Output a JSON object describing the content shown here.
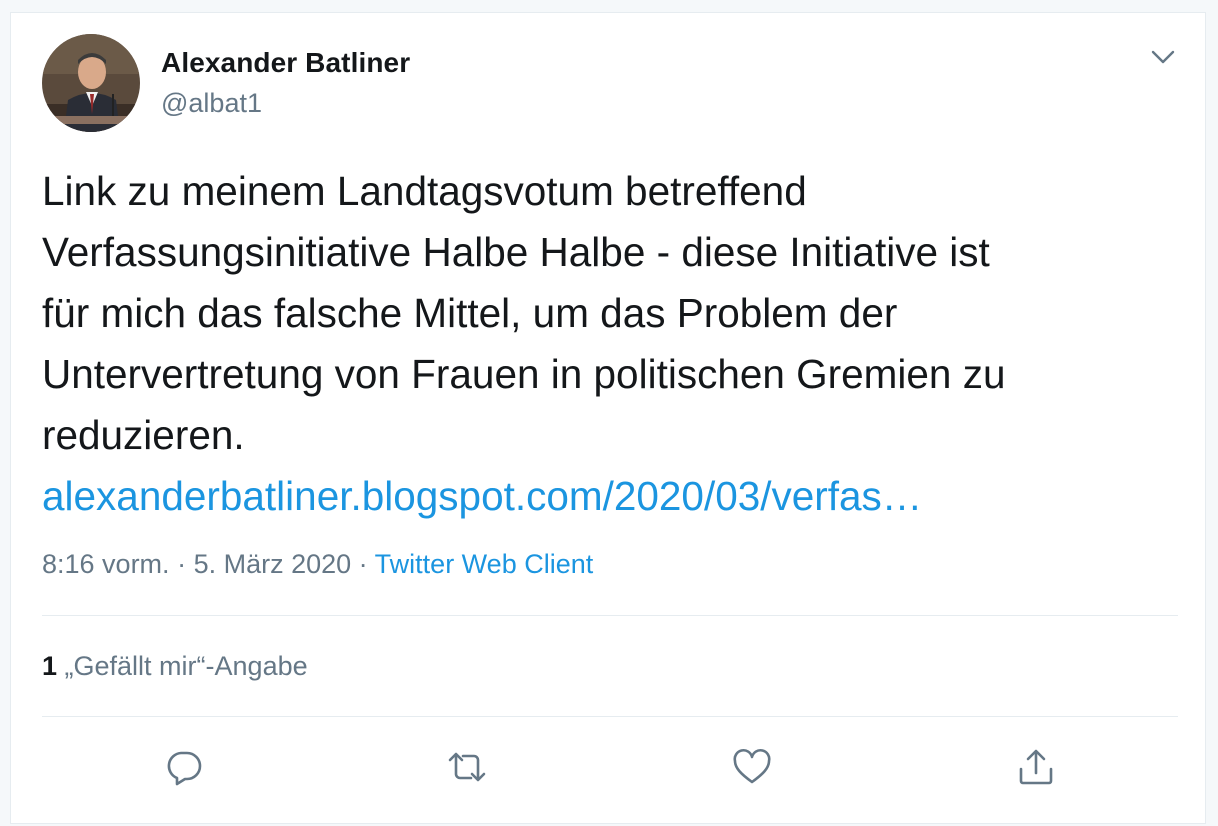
{
  "author": {
    "display_name": "Alexander Batliner",
    "handle": "@albat1",
    "avatar_icon": "profile-photo"
  },
  "tweet": {
    "text": "Link zu meinem Landtagsvotum betreffend\nVerfassungsinitiative Halbe Halbe - diese Initiative ist\nfür mich das falsche Mittel, um das Problem der\nUntervertretung von Frauen in politischen Gremien zu\nreduzieren.",
    "link_text": "alexanderbatliner.blogspot.com/2020/03/verfas…"
  },
  "meta": {
    "time": "8:16 vorm.",
    "sep1": " · ",
    "date": "5. März 2020",
    "sep2": " · ",
    "source": "Twitter Web Client"
  },
  "stats": {
    "likes_count": "1",
    "likes_label": " „Gefällt mir“-Angabe"
  },
  "actions": {
    "reply_icon": "reply-icon",
    "retweet_icon": "retweet-icon",
    "like_icon": "heart-icon",
    "share_icon": "share-icon"
  },
  "colors": {
    "link": "#1b95e0",
    "text": "#14171a",
    "secondary": "#657786",
    "border": "#e6ecf0"
  }
}
